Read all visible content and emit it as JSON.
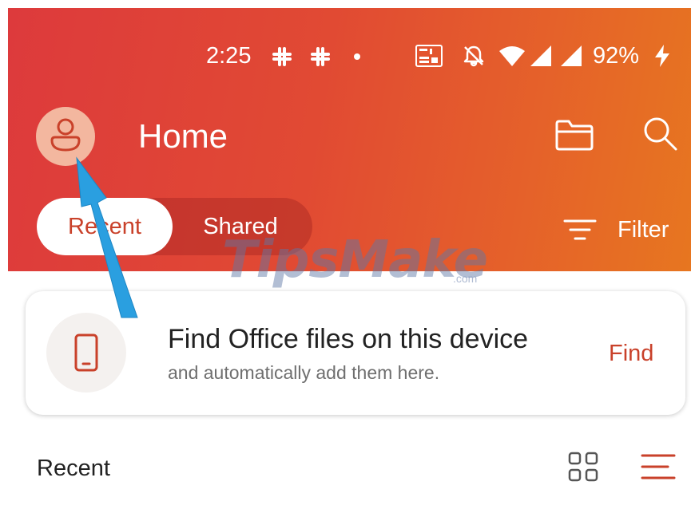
{
  "status_bar": {
    "time": "2:25",
    "battery": "92%",
    "icons": [
      "slack-icon",
      "slack-icon",
      "dot",
      "volte-lte2-icon",
      "bell-off-icon",
      "wifi-icon",
      "signal-icon",
      "signal-icon",
      "charging-bolt-icon"
    ]
  },
  "header": {
    "title": "Home",
    "avatar_icon": "profile-icon",
    "folder_icon": "folder-icon",
    "search_icon": "search-icon"
  },
  "tabs": [
    {
      "label": "Recent",
      "selected": true
    },
    {
      "label": "Shared",
      "selected": false
    }
  ],
  "filter": {
    "label": "Filter",
    "icon": "filter-icon"
  },
  "find_card": {
    "title": "Find Office files on this device",
    "subtitle": "and automatically add them here.",
    "action_label": "Find",
    "icon": "phone-icon"
  },
  "recent_section": {
    "heading": "Recent",
    "view_icons": [
      "grid-view-icon",
      "list-view-icon"
    ]
  },
  "watermark": {
    "text": "TipsMake",
    "suffix": ".com"
  },
  "colors": {
    "header_gradient_start": "#dd3a3c",
    "header_gradient_end": "#e77620",
    "accent": "#c9412a",
    "annotation_arrow": "#2a9fe0",
    "avatar_bg": "#f3b79f"
  }
}
